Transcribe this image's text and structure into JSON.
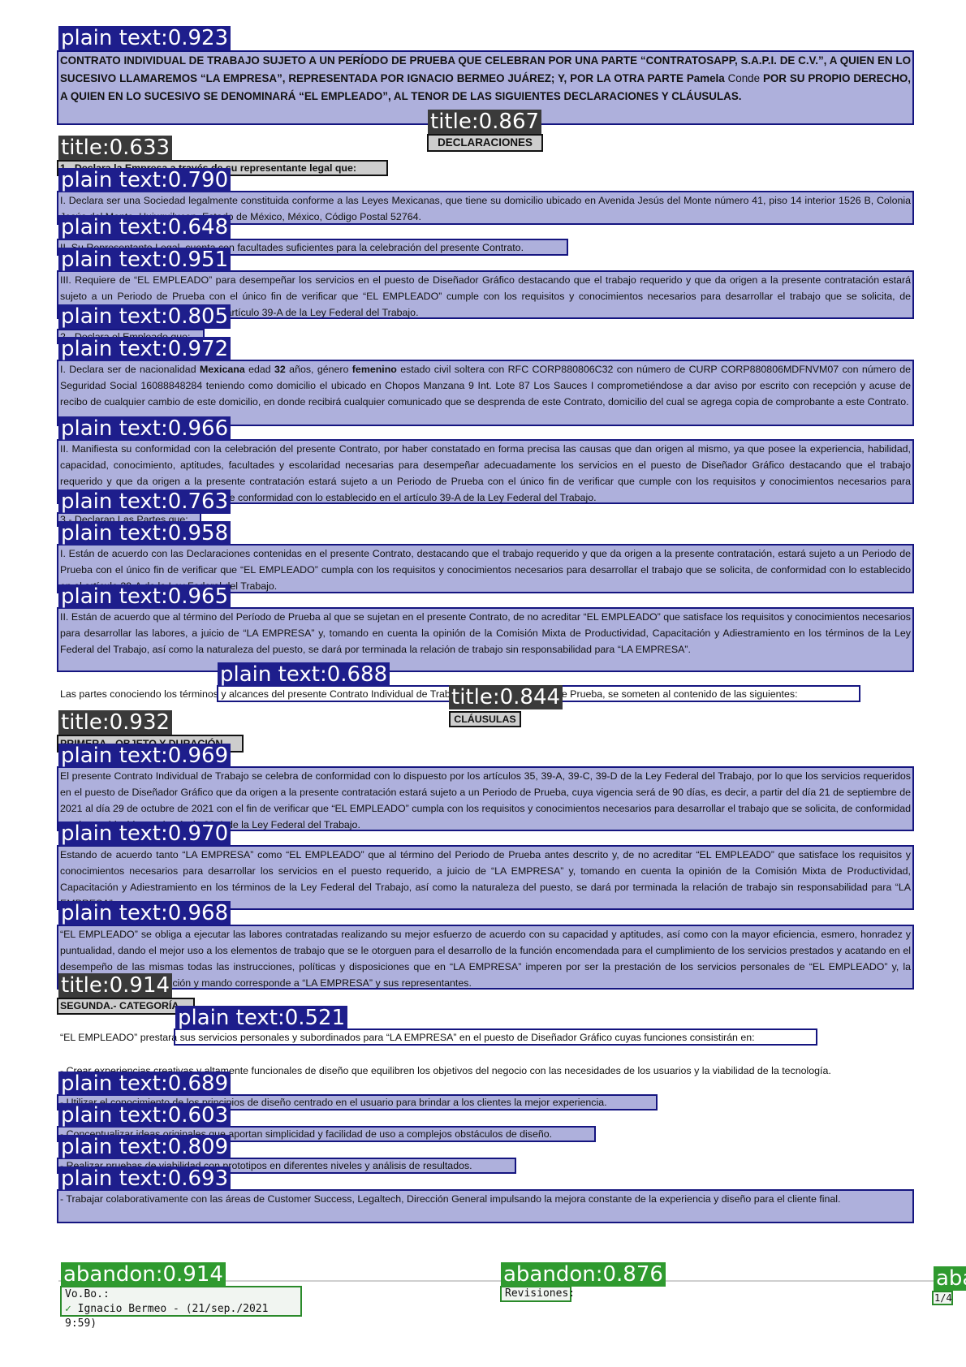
{
  "header": {
    "intro_bold_1": "CONTRATO INDIVIDUAL DE TRABAJO SUJETO A UN PERÍODO DE PRUEBA QUE CELEBRAN POR UNA PARTE “CONTRATOSAPP, S.A.P.I. DE C.V.”, A QUIEN EN LO SUCESIVO LLAMAREMOS “LA EMPRESA”, REPRESENTADA POR IGNACIO BERMEO JUÁREZ; Y, POR LA OTRA PARTE Pamela ",
    "intro_name": "Conde",
    "intro_bold_2": " POR SU PROPIO DERECHO, A QUIEN EN LO SUCESIVO SE DENOMINARÁ “EL EMPLEADO”, AL TENOR DE LAS SIGUIENTES DECLARACIONES Y CLÁUSULAS."
  },
  "sections": {
    "declaraciones_title": "DECLARACIONES",
    "empresa_heading": "1.- Declara la Empresa a través de su representante legal que:",
    "empresa_1": "I. Declara ser una Sociedad legalmente constituida conforme a las Leyes Mexicanas, que tiene su domicilio ubicado en Avenida Jesús del Monte número 41, piso 14 interior 1526 B, Colonia Jesús del Monte, Huixquilucan, Estado de México, México, Código Postal 52764.",
    "empresa_2": "II. Su Representante Legal, cuenta con facultades suficientes para la celebración del presente Contrato.",
    "empresa_3": "III. Requiere de “EL EMPLEADO” para desempeñar los servicios en el puesto de Diseñador Gráfico destacando que el trabajo requerido y que da origen a la presente contratación estará sujeto a un Periodo de Prueba con el único fin de verificar que “EL EMPLEADO” cumple con los requisitos y conocimientos necesarios para desarrollar el trabajo que se solicita, de conformidad con lo establecido en el artículo 39-A de la Ley Federal del Trabajo.",
    "empleado_heading": "2.- Declara el Empleado que:",
    "empleado_1_a": "I. Declara ser de nacionalidad ",
    "empleado_1_nat": "Mexicana",
    "empleado_1_b": " edad ",
    "empleado_1_age": "32",
    "empleado_1_c": " años, género ",
    "empleado_1_gender": "femenino",
    "empleado_1_d": " estado civil soltera con RFC CORP880806C32 con número de CURP CORP880806MDFNVM07 con número de Seguridad Social 16088848284 teniendo como domicilio el ubicado en Chopos Manzana 9 Int. Lote 87 Los Sauces I comprometiéndose a dar aviso por escrito con recepción y acuse de recibo de cualquier cambio de este domicilio, en donde recibirá cualquier comunicado que se desprenda de este Contrato, domicilio del cual se agrega copia de comprobante a este Contrato.",
    "empleado_2": "II. Manifiesta su conformidad con la celebración del presente Contrato, por haber constatado en forma precisa las causas que dan origen al mismo, ya que posee la experiencia, habilidad, capacidad, conocimiento, aptitudes, facultades y escolaridad necesarias para desempeñar adecuadamente los servicios en el puesto de Diseñador Gráfico destacando que el trabajo requerido y que da origen a la presente contratación estará sujeto a un Periodo de Prueba con el único fin de verificar que cumple con los requisitos y conocimientos necesarios para desarrollar el trabajo que se solicita, de conformidad con lo establecido en el artículo 39-A de la Ley Federal del Trabajo.",
    "partes_heading": "3.- Declaran Las Partes que:",
    "partes_1": "I. Están de acuerdo con las Declaraciones contenidas en el presente Contrato, destacando que el trabajo requerido y que da origen a la presente contratación, estará sujeto a un Periodo de Prueba con el único fin de verificar que “EL EMPLEADO” cumpla con los requisitos y conocimientos necesarios para desarrollar el trabajo que se solicita, de conformidad con lo establecido en el artículo 39-A de la Ley Federal del Trabajo.",
    "partes_2": "II. Están de acuerdo que al término del Período de Prueba al que se sujetan en el presente Contrato, de no acreditar “EL EMPLEADO” que satisface los requisitos y conocimientos necesarios para desarrollar las labores, a juicio de “LA  EMPRESA” y, tomando en cuenta la opinión de la Comisión Mixta de Productividad, Capacitación y Adiestramiento en los términos de la Ley Federal del Trabajo, así como la naturaleza del puesto, se dará por terminada la relación de trabajo sin responsabilidad para “LA EMPRESA”.",
    "partes_conociendo": "Las partes conociendo los términos y alcances del presente Contrato Individual de Trabajo sujeto a un Periodo de Prueba, se someten al contenido de las siguientes:",
    "clausulas_title": "CLÁUSULAS",
    "primera_heading": "PRIMERA.- OBJETO Y DURACIÓN",
    "primera_1": "El presente Contrato Individual de Trabajo se celebra de conformidad con lo dispuesto por los artículos 35, 39-A, 39-C, 39-D de la Ley Federal del Trabajo, por lo que los servicios requeridos en el puesto de Diseñador Gráfico que da origen a la presente contratación estará sujeto a un Periodo de Prueba, cuya vigencia será de 90 días, es decir, a partir del día 21 de septiembre de 2021 al día 29 de octubre de 2021 con el fin de verificar que “EL EMPLEADO” cumpla con los requisitos y conocimientos necesarios para desarrollar el trabajo que se solicita, de conformidad con lo establecido en el artículo 39-A de la Ley Federal del Trabajo.",
    "primera_2": "Estando de acuerdo tanto “LA  EMPRESA” como “EL EMPLEADO” que al término del Periodo de Prueba antes descrito y, de no acreditar “EL EMPLEADO” que satisface los requisitos y conocimientos necesarios para desarrollar los servicios en el puesto requerido, a juicio de “LA  EMPRESA” y, tomando en cuenta la opinión de la Comisión Mixta de Productividad, Capacitación y Adiestramiento en los términos de la Ley Federal del Trabajo, así como la naturaleza del puesto, se dará por terminada la relación de trabajo sin responsabilidad para “LA  EMPRESA”.",
    "primera_3": "“EL EMPLEADO” se obliga a ejecutar las labores contratadas realizando su mejor esfuerzo de acuerdo con su capacidad y aptitudes, así como con la mayor eficiencia, esmero, honradez y puntualidad, dando el mejor uso a los elementos de trabajo que se le otorguen para el desarrollo de la función encomendada para el cumplimiento de los servicios prestados y acatando en el desempeño de las mismas todas las instrucciones, políticas y disposiciones que en “LA EMPRESA” imperen por ser la prestación de los servicios personales de “EL EMPLEADO” y, la potestad jurídica de dirección y mando corresponde a “LA EMPRESA” y sus representantes.",
    "segunda_heading": "SEGUNDA.- CATEGORÍA",
    "segunda_intro": "“EL EMPLEADO” prestará sus servicios personales y subordinados para “LA EMPRESA” en el puesto de Diseñador Gráfico cuyas funciones consistirán en:",
    "funcion_1": "- Crear experiencias creativas y altamente funcionales de diseño que equilibren los objetivos del negocio con las necesidades de los usuarios y la viabilidad de la tecnología.",
    "funcion_2": "- Utilizar el conocimiento de los principios de diseño centrado en el usuario para brindar a los clientes la mejor experiencia.",
    "funcion_3": "- Conceptualizar ideas originales que aportan simplicidad y facilidad de uso a complejos obstáculos de diseño.",
    "funcion_4": "- Realizar pruebas de viabilidad con prototipos en diferentes niveles y análisis de resultados.",
    "funcion_5": "- Trabajar colaborativamente con las áreas de Customer Success, Legaltech, Dirección General impulsando la mejora constante de la experiencia y diseño para el cliente final."
  },
  "footer": {
    "vobo_label": "Vo.Bo.:",
    "vobo_check": "✓",
    "vobo_signer": "Ignacio Bermeo - (21/sep./2021 9:59)",
    "revisiones_label": "Revisiones:",
    "page_number": "1/4"
  },
  "tags": {
    "t01": "plain text:0.923",
    "t02": "title:0.867",
    "t03": "title:0.633",
    "t04": "plain text:0.790",
    "t05": "plain text:0.648",
    "t06": "plain text:0.951",
    "t07": "plain text:0.805",
    "t08": "plain text:0.972",
    "t09": "plain text:0.966",
    "t10": "plain text:0.763",
    "t11": "plain text:0.958",
    "t12": "plain text:0.965",
    "t13": "plain text:0.688",
    "t14": "title:0.844",
    "t15": "title:0.932",
    "t16": "plain text:0.969",
    "t17": "plain text:0.970",
    "t18": "plain text:0.968",
    "t19": "title:0.914",
    "t20": "plain text:0.521",
    "t21": "plain text:0.689",
    "t22": "plain text:0.603",
    "t23": "plain text:0.809",
    "t24": "plain text:0.693",
    "t25": "abandon:0.914",
    "t26": "abandon:0.876",
    "t27": "abandon"
  },
  "colors": {
    "plain_text_box": "#151580",
    "plain_text_fill": "#aaacda",
    "title_box": "#111111",
    "abandon_box": "#2a8a2a",
    "abandon_tag": "#2f9a2f"
  }
}
